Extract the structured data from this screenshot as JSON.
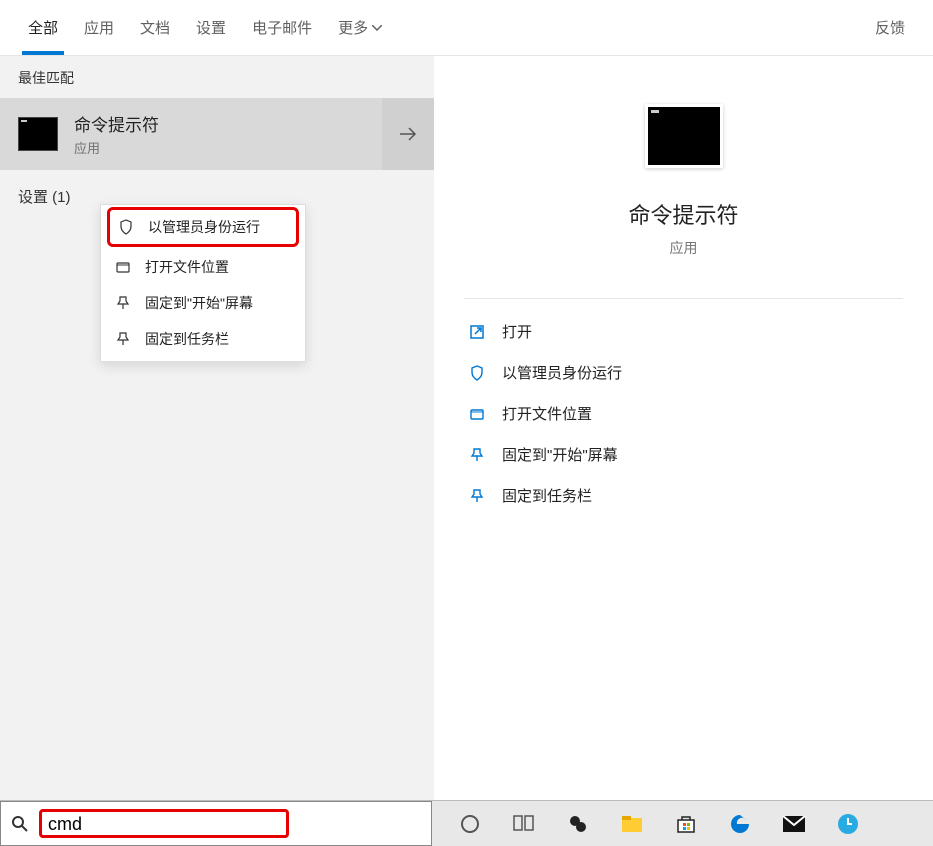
{
  "header": {
    "tabs": [
      "全部",
      "应用",
      "文档",
      "设置",
      "电子邮件"
    ],
    "more": "更多",
    "feedback": "反馈"
  },
  "left": {
    "best_match_label": "最佳匹配",
    "result": {
      "title": "命令提示符",
      "subtitle": "应用"
    },
    "settings_count": "设置 (1)"
  },
  "context_menu": {
    "items": [
      "以管理员身份运行",
      "打开文件位置",
      "固定到\"开始\"屏幕",
      "固定到任务栏"
    ]
  },
  "preview": {
    "title": "命令提示符",
    "subtitle": "应用",
    "actions": [
      "打开",
      "以管理员身份运行",
      "打开文件位置",
      "固定到\"开始\"屏幕",
      "固定到任务栏"
    ]
  },
  "search": {
    "value": "cmd"
  }
}
